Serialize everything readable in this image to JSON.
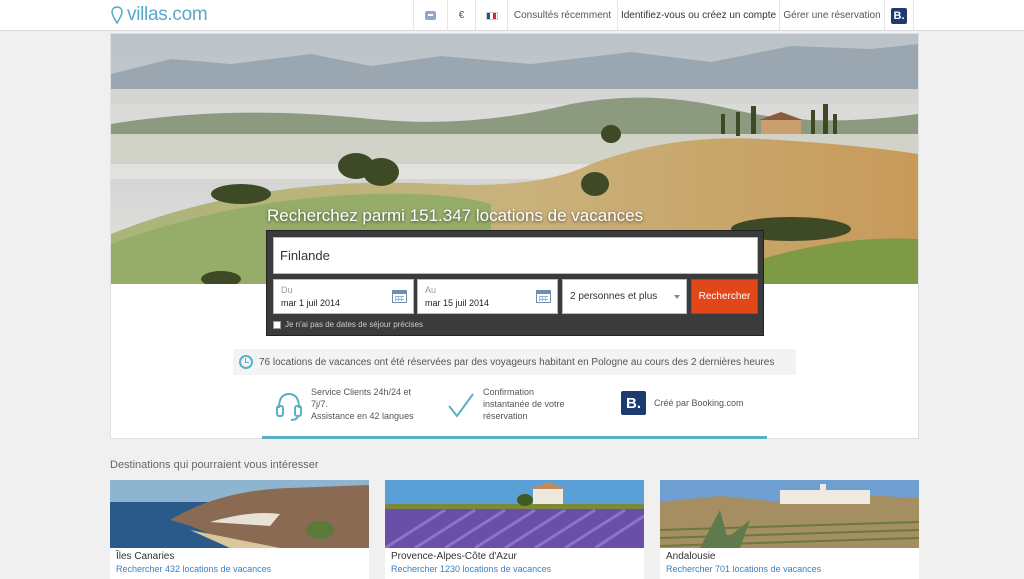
{
  "header": {
    "logo_text": "villas.com",
    "currency": "€",
    "recent_label": "Consultés récemment",
    "account_label": "Identifiez-vous ou créez un compte",
    "manage_label": "Gérer une réservation",
    "booking_badge": "B."
  },
  "hero": {
    "title": "Recherchez parmi 151.347 locations de vacances"
  },
  "search": {
    "destination_value": "Finlande",
    "checkin_label": "Du",
    "checkin_value": "mar 1 juil 2014",
    "checkout_label": "Au",
    "checkout_value": "mar 15 juil 2014",
    "guests_value": "2 personnes et plus",
    "button_label": "Rechercher",
    "no_dates_label": "Je n'ai pas de dates de séjour précises"
  },
  "booked_message": "76 locations de vacances ont été réservées par des voyageurs habitant en Pologne au cours des 2 dernières heures",
  "features": [
    {
      "line1": "Service Clients 24h/24 et",
      "line2": "7j/7.",
      "line3": "Assistance en 42 langues"
    },
    {
      "line1": "Confirmation",
      "line2": "instantanée de votre",
      "line3": "réservation"
    },
    {
      "line1": "Créé par Booking.com"
    }
  ],
  "destinations": {
    "title": "Destinations qui pourraient vous intéresser",
    "items": [
      {
        "name": "Îles Canaries",
        "link": "Rechercher 432 locations de vacances"
      },
      {
        "name": "Provence-Alpes-Côte d'Azur",
        "link": "Rechercher 1230 locations de vacances"
      },
      {
        "name": "Andalousie",
        "link": "Rechercher 701 locations de vacances"
      }
    ]
  },
  "colors": {
    "accent": "#5bb0c4",
    "search_button": "#e2471a",
    "link": "#3a7fc1",
    "booking_blue": "#1d3b6e"
  }
}
